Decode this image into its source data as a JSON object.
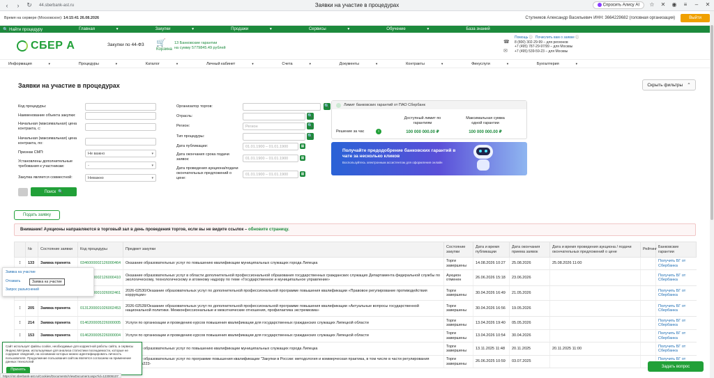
{
  "browser": {
    "url": "44.sberbank-ast.ru",
    "tab_title": "Заявки на участие в процедурах",
    "alice": "Спросить Алису AI"
  },
  "topinfo": {
    "time_label": "Время на сервере (Московское):",
    "time_value": "14:15:41 26.08.2026",
    "user": "Стулников Александр Васильевич ИНН: 3664229682 (головная организация)",
    "logout": "Выйти"
  },
  "greennav": {
    "find": "Найти процедуру",
    "items": [
      "Главная",
      "Закупки",
      "Продажи",
      "Сервисы",
      "Обучение",
      "База знаний"
    ]
  },
  "header": {
    "logo": "СБЕР А",
    "title": "Закупки по 44-ФЗ",
    "cart_label": "Корзина",
    "cart_line1": "13 Банковские гарантии",
    "cart_line2": "на сумму 5779845.49 рублей",
    "help": "Помощь",
    "rate": "Почислить вам о заявке",
    "phone1": "8 (800) 302-29-99 – для регионов",
    "phone2": "+7 (495) 787-29-97/99 – для Москвы",
    "phone3": "+7 (495) 539-59-23 – для Москвы"
  },
  "menu": [
    "Информация",
    "Процедуры",
    "Каталог",
    "Личный кабинет",
    "Счета",
    "Документы",
    "Контракты",
    "Финуслуги",
    "Бухгалтерия"
  ],
  "page": {
    "title": "Заявки на участие в процедурах",
    "hide_filters": "Скрыть фильтры"
  },
  "filters": {
    "code": "Код процедуры:",
    "name": "Наименование объекта закупки:",
    "price_from": "Начальная (максимальная) цена контракта, с:",
    "price_to": "Начальная (максимальная) цена контракта, по:",
    "smp": "Признак СМП:",
    "smp_value": "Не важно",
    "extra": "Установлены дополнительные требования к участникам:",
    "extra_value": "-",
    "joint": "Закупка является совместной:",
    "joint_value": "Неважно",
    "organizer": "Организатор торгов:",
    "branch": "Отрасль:",
    "region": "Регион:",
    "region_placeholder": "Регион",
    "proc_type": "Тип процедуры:",
    "pub_date": "Дата публикации:",
    "deadline": "Дата окончания срока подачи заявок:",
    "auction_date": "Дата проведения аукциона/подачи окончательных предложений о цене:",
    "date_ph": "01.01.1900",
    "search": "Поиск"
  },
  "limit": {
    "title": "Лимит банковских гарантий от ПАО Сбербанк",
    "col1": "Доступный лимит по гарантиям",
    "col2": "Максимальная сумма одной гарантии",
    "row": "Решение за час",
    "v1": "100 000 000.00 ₽",
    "v2": "100 000 000.00 ₽"
  },
  "banner": {
    "title": "Получайте предодобрение банковских гарантий в чате за несколько кликов",
    "sub": "Воспользуйтесь электронным ассистентом для оформления онлайн"
  },
  "apply": "Подать заявку",
  "warning": {
    "text": "Внимание! Аукционы направляются в торговый зал в день проведения торгов, если вы не видите ссылок –",
    "link": "обновите страницу."
  },
  "table": {
    "headers": [
      "",
      "№",
      "Состояние заявки",
      "Код процедуры",
      "Предмет закупки",
      "Состояние закупки",
      "Дата и время публикации",
      "Дата окончания приема заявок",
      "Дата и время проведения аукциона / подачи окончательных предложений о цене",
      "Рейтинг",
      "Банковские гарантии"
    ],
    "rows": [
      {
        "n": "133",
        "st": "Заявка принята",
        "code": "0346000002126000464",
        "subj": "Оказание образовательных услуг по повышению квалификации муниципальных служащих города Липецка",
        "ps": "Торги завершены",
        "pub": "14.08.2026 10:27",
        "end": "25.08.2026",
        "auc": "25.08.2026 11:00",
        "bg": "Получить БГ от Сбербанка"
      },
      {
        "n": "",
        "st": "",
        "code": "0346000002126000410",
        "subj": "Оказание образовательных услуг в области дополнительной профессиональной образования государственных гражданских служащих Департамента федеральной службы по экологическому, технологическому и атомному надзору по теме «Государственное и муниципальное управление»",
        "ps": "Аукцион отменен",
        "pub": "26.06.2026 15:18",
        "end": "23.06.2026",
        "auc": "",
        "bg": "Получить БГ от Сбербанка"
      },
      {
        "n": "",
        "st": "",
        "code": "0301000001026002461",
        "subj": "2026-02530/Оказание образовательных услуг по дополнительной профессиональной программе повышения квалификации «Правовое регулирование противодействия коррупции»",
        "ps": "Торги завершены",
        "pub": "30.04.2026 16:49",
        "end": "21.05.2026",
        "auc": "",
        "bg": "Получить БГ от Сбербанка"
      },
      {
        "n": "205",
        "st": "Заявка принята",
        "code": "0131200001026002453",
        "subj": "2026-02528/Оказание образовательных услуг по дополнительной профессиональной программе повышения квалификации «Актуальные вопросы государственной национальной политики. Межконфессиональные и межэтнические отношения, профилактика экстремизма»",
        "ps": "Торги завершены",
        "pub": "30.04.2026 16:56",
        "end": "19.05.2026",
        "auc": "",
        "bg": "Получить БГ от Сбербанка"
      },
      {
        "n": "214",
        "st": "Заявка принята",
        "code": "0146200005226000005",
        "subj": "Услуги по организации и проведению курсов повышения квалификации для государственных гражданских служащих Липецкой области",
        "ps": "Торги завершены",
        "pub": "13.04.2026 19:40",
        "end": "05.05.2026",
        "auc": "",
        "bg": "Получить БГ от Сбербанка"
      },
      {
        "n": "153",
        "st": "Заявка принята",
        "code": "0146200005226000004",
        "subj": "Услуги по организации и проведению курсов повышения квалификации для государственных гражданских служащих Липецкой области",
        "ps": "Торги завершены",
        "pub": "13.04.2026 10:54",
        "end": "30.04.2026",
        "auc": "",
        "bg": "Получить БГ от Сбербанка"
      },
      {
        "n": "",
        "st": "",
        "code": "",
        "subj": "Оказание образовательных услуг по повышению квалификации муниципальных служащих города Липецка",
        "ps": "Торги завершены",
        "pub": "13.11.2025 11:48",
        "end": "20.11.2025",
        "auc": "20.11.2025 11:00",
        "bg": "Получить БГ от Сбербанка"
      },
      {
        "n": "",
        "st": "",
        "code": "",
        "subj": "Оказание образовательных услуг по программе повышения квалификации \"Закупки в России: методология и коммерческая практика, в том числе в части регулирования Закона №223-",
        "ps": "Торги завершены",
        "pub": "26.06.2025 10:59",
        "end": "03.07.2025",
        "auc": "",
        "bg": "Получить БГ от Сбербанка"
      }
    ]
  },
  "popup": {
    "item1": "Заявка на участие",
    "item2": "Отозвать",
    "tip": "Заявка на участие",
    "item3": "Запрос разъяснений"
  },
  "cookie": {
    "text": "Сайт использует файлы cookie, необходимые для корректной работы сайта, а сервисы Яндекс.Метрики, используемые для анализа статистики посещаемости, которые не содержат сведений, на основании которых можно идентифицировать личность пользователя. Продолжение пользования сайтом является согласием на применение данных технологий",
    "accept": "Принять"
  },
  "status_url": "https://44.sberbank-ast.ru/Cookies/Documents/ViewDocument.aspx?id=123006107",
  "ask": "Задать вопрос"
}
